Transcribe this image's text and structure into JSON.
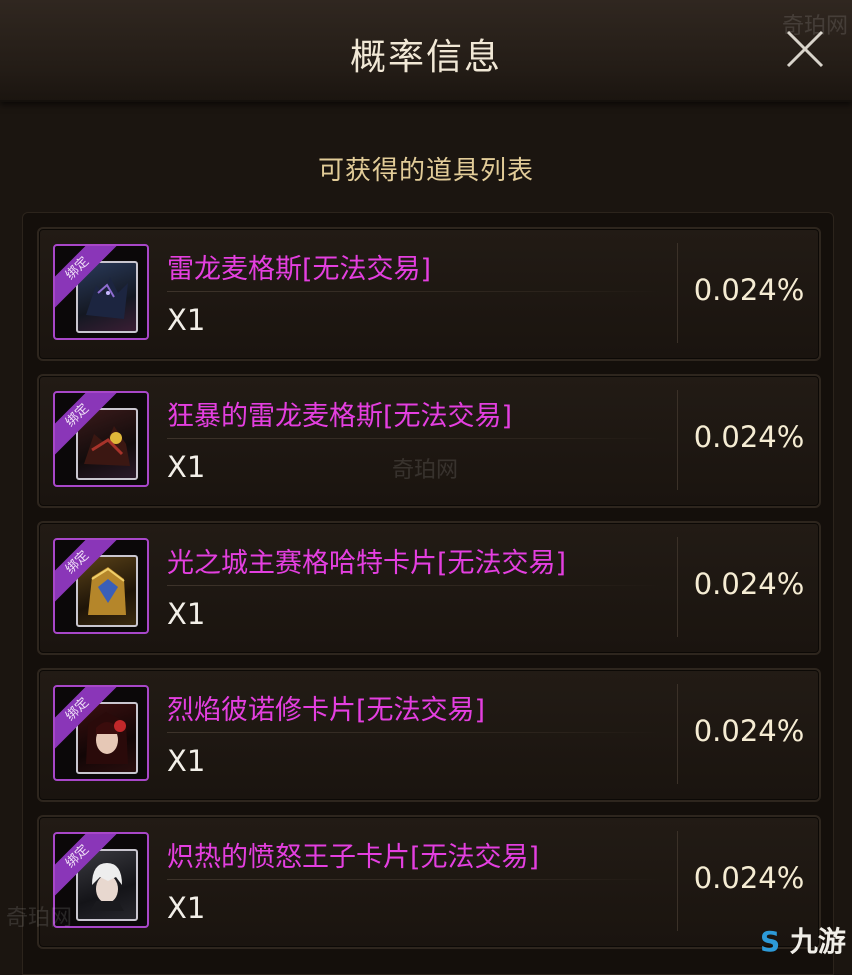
{
  "header": {
    "title": "概率信息"
  },
  "subtitle": "可获得的道具列表",
  "bound_label": "绑定",
  "watermarks": {
    "text": "奇珀网",
    "logo": "九游"
  },
  "items": [
    {
      "name": "雷龙麦格斯[无法交易]",
      "qty": "X1",
      "prob": "0.024%",
      "art": "dark-dragon"
    },
    {
      "name": "狂暴的雷龙麦格斯[无法交易]",
      "qty": "X1",
      "prob": "0.024%",
      "art": "red-dragon"
    },
    {
      "name": "光之城主赛格哈特卡片[无法交易]",
      "qty": "X1",
      "prob": "0.024%",
      "art": "gold-knight"
    },
    {
      "name": "烈焰彼诺修卡片[无法交易]",
      "qty": "X1",
      "prob": "0.024%",
      "art": "red-hair-girl"
    },
    {
      "name": "炽热的愤怒王子卡片[无法交易]",
      "qty": "X1",
      "prob": "0.024%",
      "art": "white-hair-boy"
    }
  ],
  "colors": {
    "item_name": "#e43fe0",
    "bound_badge": "#8a36b8",
    "probability": "#f5ecd3"
  }
}
